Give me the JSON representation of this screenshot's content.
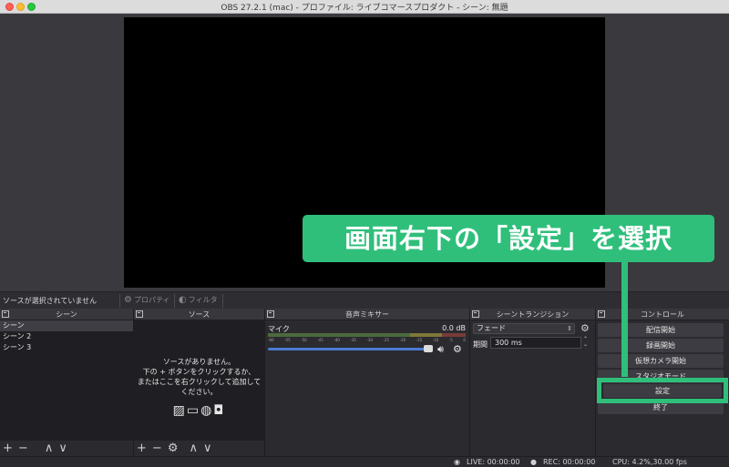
{
  "window": {
    "title": "OBS 27.2.1 (mac) - プロファイル: ライブコマースプロダクト - シーン: 無題"
  },
  "source_toolbar": {
    "no_source_text": "ソースが選択されていません",
    "properties_label": "プロパティ",
    "filters_label": "フィルタ"
  },
  "scenes": {
    "title": "シーン",
    "items": [
      "シーン",
      "シーン 2",
      "シーン 3"
    ],
    "footer": [
      "+",
      "−",
      "∧",
      "∨"
    ]
  },
  "sources": {
    "title": "ソース",
    "empty_lines": [
      "ソースがありません。",
      "下の + ボタンをクリックするか、",
      "またはここを右クリックして追加して",
      "ください。"
    ],
    "footer": [
      "+",
      "−",
      "⚙",
      "∧",
      "∨"
    ]
  },
  "mixer": {
    "title": "音声ミキサー",
    "channel": "マイク",
    "level": "0.0 dB",
    "ticks": [
      "-60",
      "-55",
      "-50",
      "-45",
      "-40",
      "-35",
      "-30",
      "-25",
      "-20",
      "-15",
      "-10",
      "-5",
      "0"
    ],
    "volume_fraction": 1.0
  },
  "transitions": {
    "title": "シーントランジション",
    "selected": "フェード",
    "duration_label": "期間",
    "duration_value": "300 ms"
  },
  "controls": {
    "title": "コントロール",
    "buttons": [
      "配信開始",
      "録画開始",
      "仮想カメラ開始",
      "スタジオモード",
      "設定",
      "終了"
    ]
  },
  "status": {
    "live": "LIVE: 00:00:00",
    "rec": "REC: 00:00:00",
    "cpu": "CPU: 4.2%,30.00 fps"
  },
  "annotation": {
    "callout_text": "画面右下の「設定」を選択",
    "accent_color": "#2fbf7b"
  },
  "icons": {
    "float": "dock-float-icon",
    "gear": "gear-icon",
    "speaker": "speaker-icon",
    "image": "image-icon",
    "display": "display-icon",
    "globe": "globe-icon",
    "camera": "camera-icon"
  }
}
